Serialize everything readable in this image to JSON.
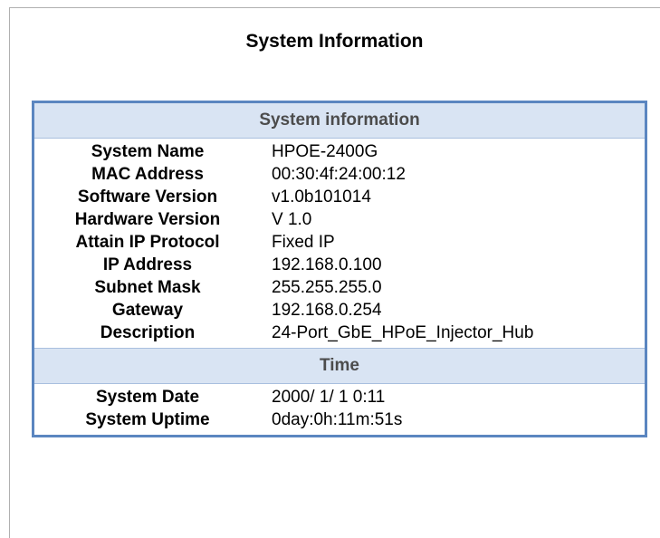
{
  "page": {
    "title": "System Information"
  },
  "system_information": {
    "header": "System information",
    "rows": [
      {
        "label": "System Name",
        "value": "HPOE-2400G"
      },
      {
        "label": "MAC Address",
        "value": "00:30:4f:24:00:12"
      },
      {
        "label": "Software Version",
        "value": "v1.0b101014"
      },
      {
        "label": "Hardware Version",
        "value": "V 1.0"
      },
      {
        "label": "Attain IP Protocol",
        "value": "Fixed IP"
      },
      {
        "label": "IP Address",
        "value": "192.168.0.100"
      },
      {
        "label": "Subnet Mask",
        "value": "255.255.255.0"
      },
      {
        "label": "Gateway",
        "value": "192.168.0.254"
      },
      {
        "label": "Description",
        "value": "24-Port_GbE_HPoE_Injector_Hub"
      }
    ]
  },
  "time": {
    "header": "Time",
    "rows": [
      {
        "label": "System Date",
        "value": "2000/ 1/ 1 0:11"
      },
      {
        "label": "System Uptime",
        "value": "0day:0h:11m:51s"
      }
    ]
  },
  "colors": {
    "table_border": "#5b86c0",
    "header_background": "#d9e4f3",
    "header_text": "#4c4c4c"
  }
}
